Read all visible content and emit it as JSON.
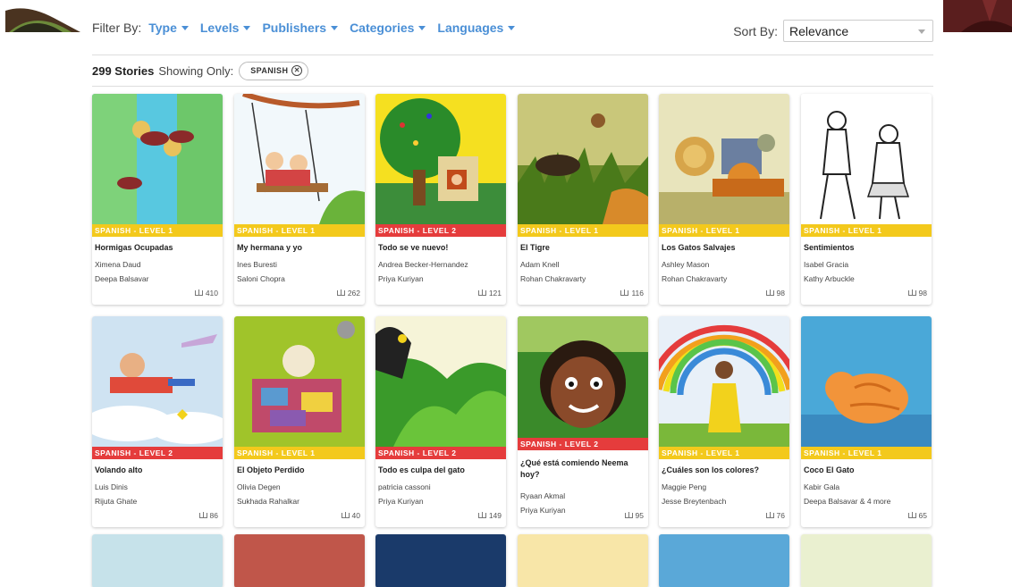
{
  "filters": {
    "label": "Filter By:",
    "options": [
      "Type",
      "Levels",
      "Publishers",
      "Categories",
      "Languages"
    ]
  },
  "sort": {
    "label": "Sort By:",
    "value": "Relevance"
  },
  "results": {
    "count": "299 Stories",
    "showing_label": "Showing Only:",
    "chip": "SPANISH"
  },
  "colors": {
    "accent": "#4a8fd6",
    "level1": "#f3c91c",
    "level2": "#e53c3c"
  },
  "stories": [
    {
      "level": "SPANISH - LEVEL 1",
      "level_num": 1,
      "title": "Hormigas Ocupadas",
      "authors": [
        "Ximena Daud",
        "Deepa Balsavar"
      ],
      "reads": "410"
    },
    {
      "level": "SPANISH - LEVEL 1",
      "level_num": 1,
      "title": "My hermana y yo",
      "authors": [
        "Ines Buresti",
        "Saloni Chopra"
      ],
      "reads": "262"
    },
    {
      "level": "SPANISH - LEVEL 2",
      "level_num": 2,
      "title": "Todo se ve nuevo!",
      "authors": [
        "Andrea Becker-Hernandez",
        "Priya Kuriyan"
      ],
      "reads": "121"
    },
    {
      "level": "SPANISH - LEVEL 1",
      "level_num": 1,
      "title": "El Tigre",
      "authors": [
        "Adam Knell",
        "Rohan Chakravarty"
      ],
      "reads": "116"
    },
    {
      "level": "SPANISH - LEVEL 1",
      "level_num": 1,
      "title": "Los Gatos Salvajes",
      "authors": [
        "Ashley Mason",
        "Rohan Chakravarty"
      ],
      "reads": "98"
    },
    {
      "level": "SPANISH - LEVEL 1",
      "level_num": 1,
      "title": "Sentimientos",
      "authors": [
        "Isabel Gracia",
        "Kathy Arbuckle"
      ],
      "reads": "98"
    },
    {
      "level": "SPANISH - LEVEL 2",
      "level_num": 2,
      "title": "Volando alto",
      "authors": [
        "Luis Dinis",
        "Rijuta Ghate"
      ],
      "reads": "86"
    },
    {
      "level": "SPANISH - LEVEL 1",
      "level_num": 1,
      "title": "El Objeto Perdido",
      "authors": [
        "Olivia Degen",
        "Sukhada Rahalkar"
      ],
      "reads": "40"
    },
    {
      "level": "SPANISH - LEVEL 2",
      "level_num": 2,
      "title": "Todo es culpa del gato",
      "authors": [
        "patricia cassoni",
        "Priya Kuriyan"
      ],
      "reads": "149"
    },
    {
      "level": "SPANISH - LEVEL 2",
      "level_num": 2,
      "title": "¿Qué está comiendo Neema hoy?",
      "authors": [
        "Ryaan Akmal",
        "Priya Kuriyan"
      ],
      "reads": "95"
    },
    {
      "level": "SPANISH - LEVEL 1",
      "level_num": 1,
      "title": "¿Cuáles son los colores?",
      "authors": [
        "Maggie Peng",
        "Jesse Breytenbach"
      ],
      "reads": "76"
    },
    {
      "level": "SPANISH - LEVEL 1",
      "level_num": 1,
      "title": "Coco El Gato",
      "authors": [
        "Kabir Gala",
        "Deepa Balsavar & 4 more"
      ],
      "reads": "65"
    }
  ]
}
